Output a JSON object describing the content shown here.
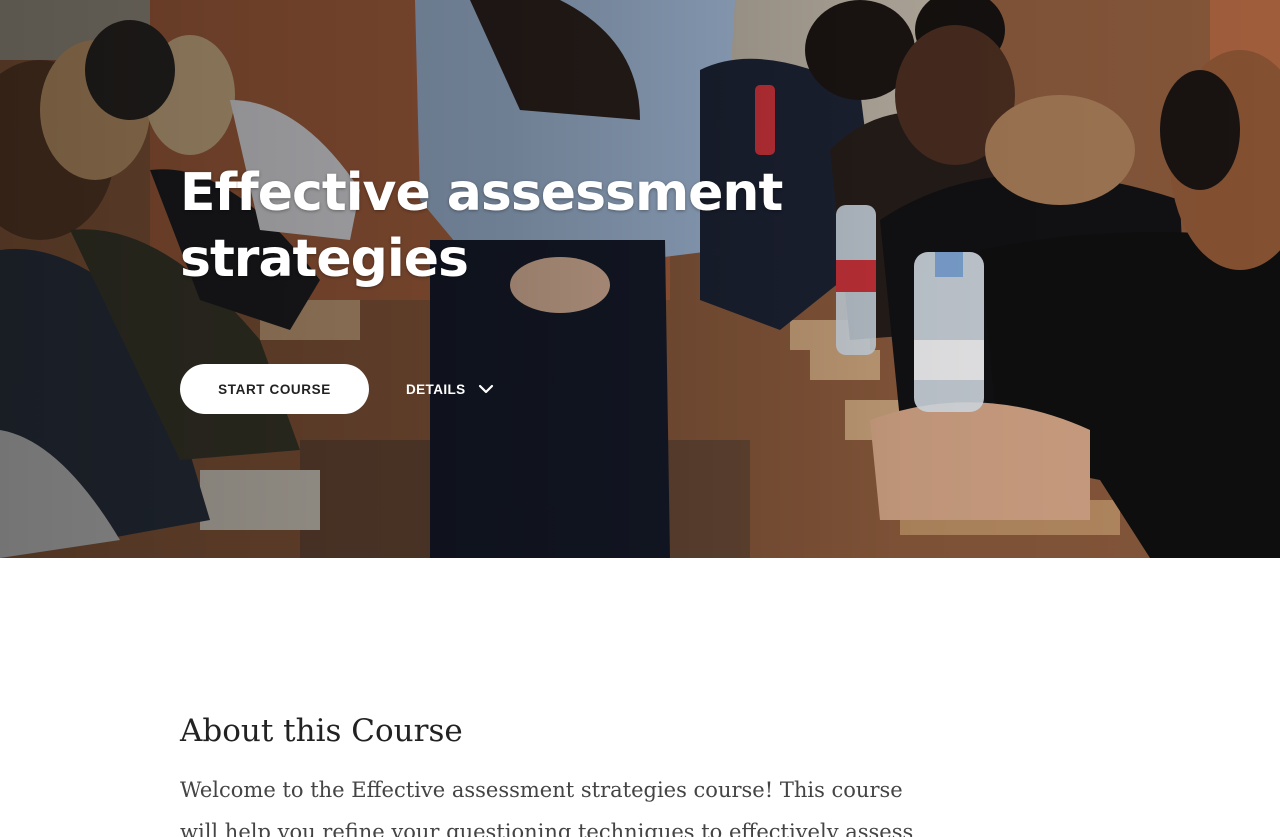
{
  "hero": {
    "title": "Effective assessment strategies",
    "start_label": "START COURSE",
    "details_label": "DETAILS",
    "details_icon": "chevron-down-icon",
    "photo_description_icon": "classroom-photo"
  },
  "about": {
    "heading": "About this Course",
    "text": "Welcome to the Effective assessment strategies course! This course will help you refine your questioning techniques to effectively assess"
  },
  "colors": {
    "button_bg": "#ffffff",
    "button_text": "#222222",
    "heading_text": "#222222",
    "body_text": "#444444"
  }
}
